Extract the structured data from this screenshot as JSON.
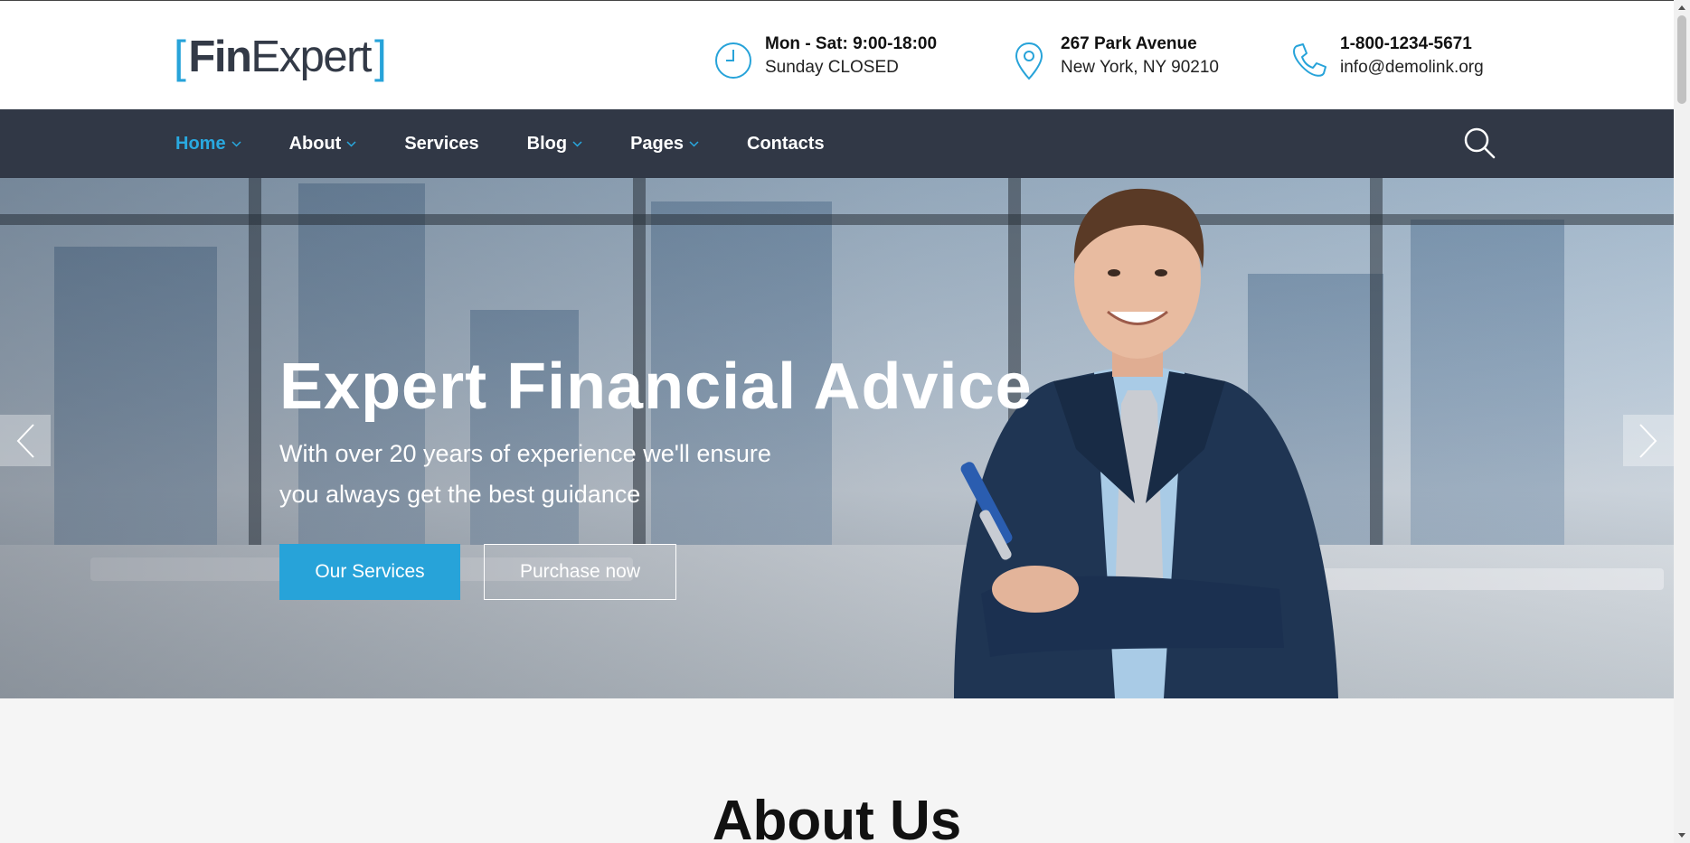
{
  "header": {
    "logo": {
      "bracket_left": "[",
      "fin": "Fin",
      "expert": "Expert",
      "bracket_right": "]"
    },
    "hours": {
      "line1": "Mon - Sat: 9:00-18:00",
      "line2": "Sunday CLOSED",
      "icon": "clock-icon"
    },
    "address": {
      "line1": "267 Park Avenue",
      "line2": "New York, NY 90210",
      "icon": "location-pin-icon"
    },
    "contact": {
      "phone": "1-800-1234-5671",
      "email": "info@demolink.org",
      "icon": "phone-icon"
    }
  },
  "nav": {
    "items": [
      {
        "label": "Home",
        "dropdown": true,
        "active": true
      },
      {
        "label": "About",
        "dropdown": true,
        "active": false
      },
      {
        "label": "Services",
        "dropdown": false,
        "active": false
      },
      {
        "label": "Blog",
        "dropdown": true,
        "active": false
      },
      {
        "label": "Pages",
        "dropdown": true,
        "active": false
      },
      {
        "label": "Contacts",
        "dropdown": false,
        "active": false
      }
    ],
    "search_icon": "search-icon"
  },
  "hero": {
    "title": "Expert Financial Advice",
    "subtitle_line1": "With over 20 years of experience we'll ensure",
    "subtitle_line2": "you always get the best guidance",
    "primary_button": "Our Services",
    "secondary_button": "Purchase now"
  },
  "about": {
    "title": "About Us"
  },
  "colors": {
    "accent": "#27a3d9",
    "nav_bg": "#313846",
    "logo_dark": "#333a47"
  }
}
